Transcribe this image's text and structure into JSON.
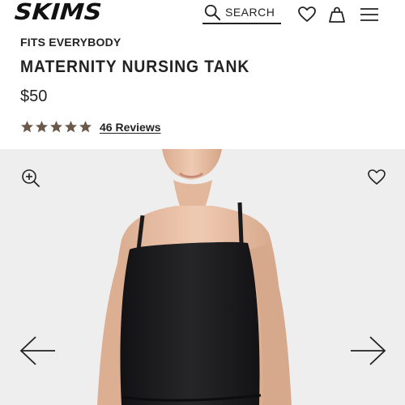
{
  "header": {
    "brand_logo": "SKIMS",
    "search_label": "SEARCH",
    "icons": [
      "search-icon",
      "heart-icon",
      "bag-icon",
      "menu-icon"
    ]
  },
  "product": {
    "collection": "FITS EVERYBODY",
    "name": "MATERNITY NURSING TANK",
    "price": "$50",
    "rating": 5,
    "reviews_label": "46 Reviews"
  },
  "gallery": {
    "icons": [
      "zoom-in-icon",
      "heart-icon",
      "arrow-left-icon",
      "arrow-right-icon"
    ]
  },
  "colors": {
    "star": "#6b5a4b",
    "gallery_bg": "#eeeeee",
    "garment": "#1c1c1e",
    "skin": "#e9c1a7"
  }
}
